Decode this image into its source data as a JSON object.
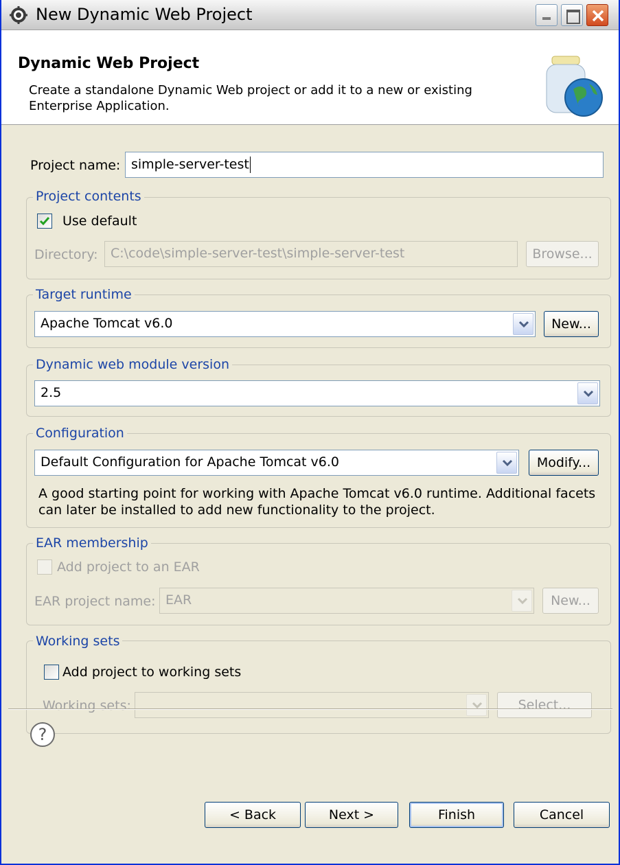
{
  "window": {
    "title": "New Dynamic Web Project"
  },
  "header": {
    "title": "Dynamic Web Project",
    "description": "Create a standalone Dynamic Web project or add it to a new or existing Enterprise Application."
  },
  "project": {
    "name_label": "Project name:",
    "name_value": "simple-server-test"
  },
  "project_contents": {
    "title": "Project contents",
    "use_default_label": "Use default",
    "use_default_checked": true,
    "directory_label": "Directory:",
    "directory_value": "C:\\code\\simple-server-test\\simple-server-test",
    "browse_label": "Browse..."
  },
  "target_runtime": {
    "title": "Target runtime",
    "value": "Apache Tomcat v6.0",
    "new_label": "New..."
  },
  "module_version": {
    "title": "Dynamic web module version",
    "value": "2.5"
  },
  "configuration": {
    "title": "Configuration",
    "value": "Default Configuration for Apache Tomcat v6.0",
    "modify_label": "Modify...",
    "description": "A good starting point for working with Apache Tomcat v6.0 runtime. Additional facets can later be installed to add new functionality to the project."
  },
  "ear": {
    "title": "EAR membership",
    "add_label": "Add project to an EAR",
    "name_label": "EAR project name:",
    "name_value": "EAR",
    "new_label": "New..."
  },
  "working_sets": {
    "title": "Working sets",
    "add_label": "Add project to working sets",
    "sets_label": "Working sets:",
    "sets_value": "",
    "select_label": "Select..."
  },
  "buttons": {
    "back": "< Back",
    "next": "Next >",
    "finish": "Finish",
    "cancel": "Cancel"
  },
  "icons": {
    "title": "gear-icon",
    "header": "globe-jar-icon",
    "help": "help-icon"
  },
  "help_glyph": "?"
}
